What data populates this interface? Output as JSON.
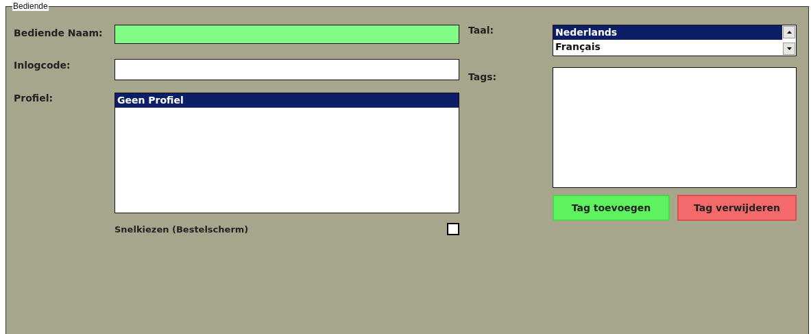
{
  "group": {
    "title": "Bediende"
  },
  "fields": [
    {
      "label": "Bediende Naam:",
      "highlighted": true
    },
    {
      "label": "Inlogcode:",
      "highlighted": false
    }
  ],
  "profile": {
    "label": "Profiel:",
    "items": [
      {
        "text": "Geen Profiel",
        "selected": true
      }
    ]
  },
  "quick_select": {
    "label": "Snelkiezen (Bestelscherm)",
    "checked": false
  },
  "language": {
    "label": "Taal:",
    "items": [
      {
        "text": "Nederlands",
        "selected": true
      },
      {
        "text": "Français",
        "selected": false
      }
    ]
  },
  "tags": {
    "label": "Tags:"
  },
  "buttons": [
    {
      "label": "Tag toevoegen",
      "kind": "add"
    },
    {
      "label": "Tag verwijderen",
      "kind": "remove"
    }
  ]
}
